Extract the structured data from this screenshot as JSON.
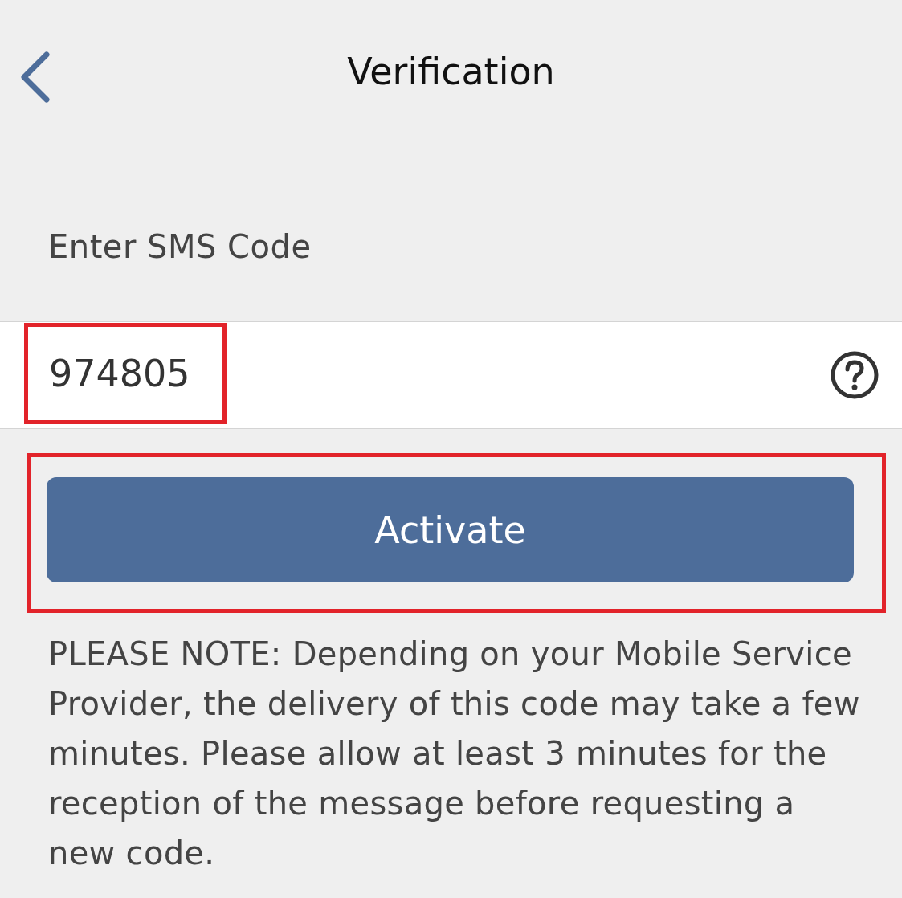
{
  "header": {
    "title": "Verification"
  },
  "code_field": {
    "label": "Enter SMS Code",
    "value": "974805",
    "highlighted": true
  },
  "activate_button": {
    "label": "Activate",
    "highlighted": true
  },
  "note": "PLEASE NOTE: Depending on your Mobile Service Provider, the delivery of this code may take a few minutes. Please allow at least 3 minutes for the reception of the message before requesting a new code."
}
